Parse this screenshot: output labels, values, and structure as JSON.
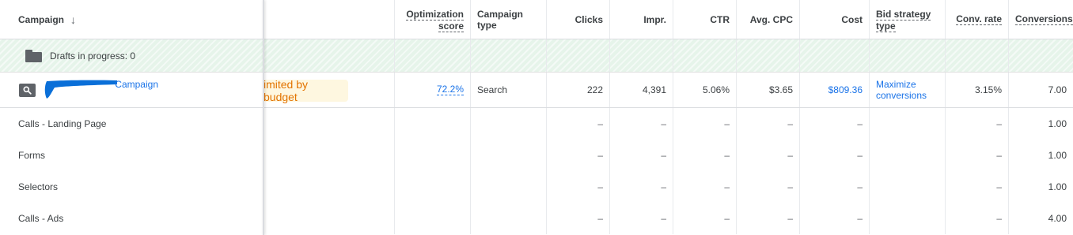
{
  "header": {
    "campaign": "Campaign",
    "sort_icon": "↓",
    "optimization_score": [
      "Optimization",
      "score"
    ],
    "campaign_type": [
      "Campaign",
      "type"
    ],
    "clicks": "Clicks",
    "impr": "Impr.",
    "ctr": "CTR",
    "avg_cpc": "Avg. CPC",
    "cost": "Cost",
    "bid_strategy_type": [
      "Bid strategy",
      "type"
    ],
    "conv_rate": "Conv. rate",
    "conversions": "Conversions"
  },
  "drafts": {
    "icon": "folder-icon",
    "label": "Drafts in progress: 0"
  },
  "campaign": {
    "icon": "search-icon",
    "name": "Campaign",
    "name_redacted": true,
    "status": "imited by budget",
    "optimization_score": "72.2%",
    "campaign_type": "Search",
    "clicks": "222",
    "impr": "4,391",
    "ctr": "5.06%",
    "avg_cpc": "$3.65",
    "cost": "$809.36",
    "bid_strategy_type": "Maximize conversions",
    "conv_rate": "3.15%",
    "conversions": "7.00"
  },
  "dash": "–",
  "conversion_actions": [
    {
      "name": "Calls - Landing Page",
      "conversions": "1.00"
    },
    {
      "name": "Forms",
      "conversions": "1.00"
    },
    {
      "name": "Selectors",
      "conversions": "1.00"
    },
    {
      "name": "Calls - Ads",
      "conversions": "4.00"
    }
  ],
  "colors": {
    "link_blue": "#1a73e8",
    "drafts_green": "#e6f4ea",
    "budget_chip_bg": "#fef7e0",
    "budget_chip_text": "#e37400",
    "redaction_blue": "#0a6fd8"
  }
}
